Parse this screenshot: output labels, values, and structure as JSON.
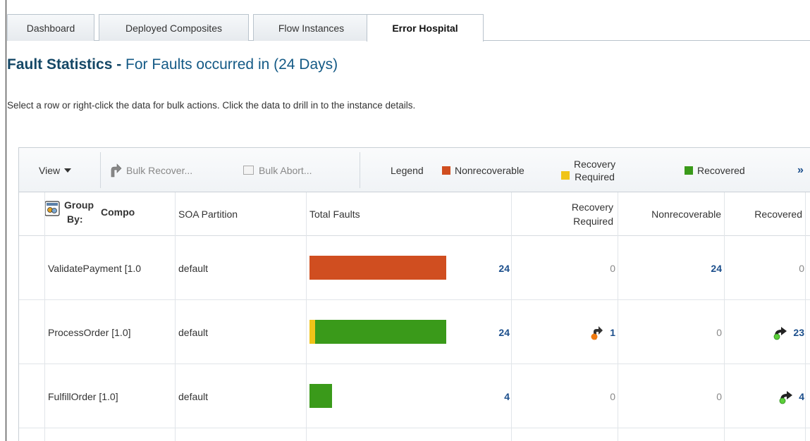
{
  "tabs": [
    {
      "label": "Dashboard",
      "active": false
    },
    {
      "label": "Deployed Composites",
      "active": false
    },
    {
      "label": "Flow Instances",
      "active": false
    },
    {
      "label": "Error Hospital",
      "active": true
    }
  ],
  "title": {
    "main": "Fault Statistics -",
    "sub": "For Faults occurred in (24 Days)"
  },
  "instructions": "Select a row or right-click the data for bulk actions. Click the data to drill in to the instance details.",
  "toolbar": {
    "view_label": "View",
    "bulk_recover_label": "Bulk Recover...",
    "bulk_abort_label": "Bulk Abort...",
    "legend_label": "Legend",
    "legend_items": [
      {
        "label": "Nonrecoverable",
        "color": "#d04e20"
      },
      {
        "label_line1": "Recovery",
        "label_line2": "Required",
        "color": "#f0c419"
      },
      {
        "label": "Recovered",
        "color": "#3a9a1a"
      }
    ],
    "overflow_label": "»"
  },
  "table": {
    "group_by_line1": "Group",
    "group_by_line2": "By:",
    "composite_header": "Compo",
    "columns": {
      "soa_partition": "SOA Partition",
      "total_faults": "Total Faults",
      "recovery_required_line1": "Recovery",
      "recovery_required_line2": "Required",
      "nonrecoverable": "Nonrecoverable",
      "recovered": "Recovered"
    },
    "max_faults": 24,
    "rows": [
      {
        "composite": "ValidatePayment [1.0",
        "partition": "default",
        "total": "24",
        "recovery_required": "0",
        "nonrecoverable": "24",
        "recovered": "0",
        "breakdown": {
          "recovery_required": 0,
          "nonrecoverable": 24,
          "recovered": 0
        }
      },
      {
        "composite": "ProcessOrder [1.0]",
        "partition": "default",
        "total": "24",
        "recovery_required": "1",
        "nonrecoverable": "0",
        "recovered": "23",
        "breakdown": {
          "recovery_required": 1,
          "nonrecoverable": 0,
          "recovered": 23
        }
      },
      {
        "composite": "FulfillOrder [1.0]",
        "partition": "default",
        "total": "4",
        "recovery_required": "0",
        "nonrecoverable": "0",
        "recovered": "4",
        "breakdown": {
          "recovery_required": 0,
          "nonrecoverable": 0,
          "recovered": 4
        }
      }
    ]
  }
}
